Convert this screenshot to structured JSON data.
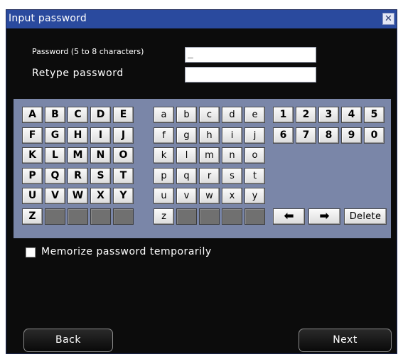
{
  "dialog": {
    "title": "Input password",
    "close_glyph": "✕"
  },
  "form": {
    "password_label": "Password (5 to 8 characters)",
    "password_value": "_",
    "retype_label": "Retype password",
    "retype_value": ""
  },
  "keypad": {
    "uppercase": [
      "A",
      "B",
      "C",
      "D",
      "E",
      "F",
      "G",
      "H",
      "I",
      "J",
      "K",
      "L",
      "M",
      "N",
      "O",
      "P",
      "Q",
      "R",
      "S",
      "T",
      "U",
      "V",
      "W",
      "X",
      "Y",
      "Z"
    ],
    "lowercase": [
      "a",
      "b",
      "c",
      "d",
      "e",
      "f",
      "g",
      "h",
      "i",
      "j",
      "k",
      "l",
      "m",
      "n",
      "o",
      "p",
      "q",
      "r",
      "s",
      "t",
      "u",
      "v",
      "w",
      "x",
      "y",
      "z"
    ],
    "digits": [
      "1",
      "2",
      "3",
      "4",
      "5",
      "6",
      "7",
      "8",
      "9",
      "0"
    ],
    "left_arrow": "⬅",
    "right_arrow": "➡",
    "delete_label": "Delete"
  },
  "memorize": {
    "label": "Memorize password temporarily",
    "checked": false
  },
  "buttons": {
    "back": "Back",
    "next": "Next"
  },
  "colors": {
    "titlebar": "#2a4a9e",
    "dialog_bg": "#0c0c0c",
    "keypad_bg": "#7a86a8",
    "key_face": "#efefef",
    "key_empty": "#707070"
  }
}
